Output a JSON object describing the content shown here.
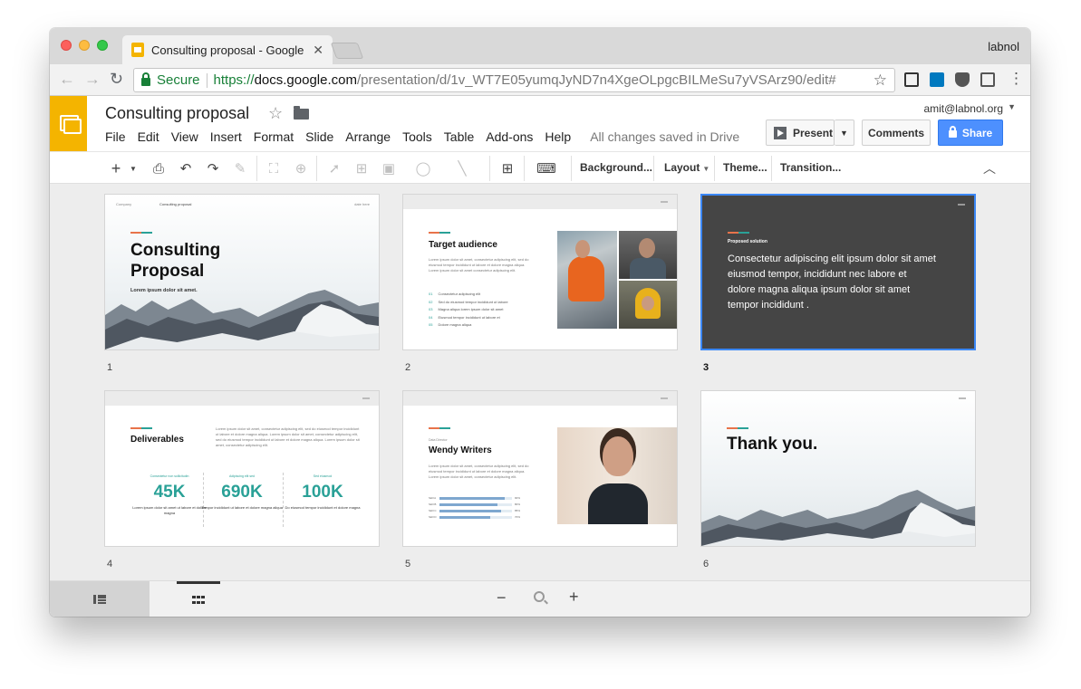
{
  "browser": {
    "tab_title": "Consulting proposal - Google S",
    "profile_name": "labnol",
    "secure_label": "Secure",
    "url_protocol": "https://",
    "url_host": "docs.google.com",
    "url_path": "/presentation/d/1v_WT7E05yumqJyND7n4XgeOLpgcBILMeSu7yVSArz90/edit#"
  },
  "docs": {
    "title": "Consulting proposal",
    "menu": [
      "File",
      "Edit",
      "View",
      "Insert",
      "Format",
      "Slide",
      "Arrange",
      "Tools",
      "Table",
      "Add-ons",
      "Help"
    ],
    "save_status": "All changes saved in Drive",
    "account": "amit@labnol.org",
    "present_label": "Present",
    "comments_label": "Comments",
    "share_label": "Share"
  },
  "toolbar": {
    "background_label": "Background...",
    "layout_label": "Layout",
    "theme_label": "Theme...",
    "transition_label": "Transition..."
  },
  "slides": [
    {
      "number": "1",
      "top_left": "Company",
      "top_mid": "Consulting proposal",
      "top_right": "date here",
      "title": "Consulting Proposal",
      "subtitle": "Lorem ipsum dolor sit amet."
    },
    {
      "number": "2",
      "title": "Target audience",
      "body": "Lorem ipsum dolor sit amet, consectetur adipiscing elit, sed do eiusmod tempor incididunt ut labore et dolore magna aliqua. Lorem ipsum dolor sit amet consectetur adipiscing elit.",
      "items": [
        {
          "n": "01",
          "text": "Consectetur adipiscing elit"
        },
        {
          "n": "02",
          "text": "Sed do eiusmod tempor incididunt ut labore"
        },
        {
          "n": "03",
          "text": "Magna aliqua lorem ipsum dolor sit amet"
        },
        {
          "n": "04",
          "text": "Eiusmod tempor incididunt ut labore et"
        },
        {
          "n": "05",
          "text": "Dolore magna aliqua"
        }
      ]
    },
    {
      "number": "3",
      "label": "Proposed solution",
      "text": "Consectetur adipiscing elit ipsum dolor sit amet eiusmod tempor, incididunt nec labore et dolore magna aliqua ipsum dolor sit amet tempor incididunt ."
    },
    {
      "number": "4",
      "title": "Deliverables",
      "body": "Lorem ipsum dolor sit amet, consectetur adipiscing elit, sed do eiusmod tempor incididunt ut labore et dolore magna aliqua. Lorem ipsum dolor sit amet, consectetur adipiscing elit, sed do eiusmod tempor incididunt ut labore et dolore magna aliqua. Lorem ipsum dolor sit amet, consectetur adipiscing elit.",
      "stats": [
        {
          "label": "Consectetur non sollicitudin",
          "value": "45K",
          "desc": "Lorem ipsum dolor sit amet ut labore et dolore magna"
        },
        {
          "label": "Adipiscing elit sed",
          "value": "690K",
          "desc": "Tempor incididunt ut labore et dolore magna aliqua"
        },
        {
          "label": "Sed eiusmod",
          "value": "100K",
          "desc": "Do eiusmod tempor incididunt et dolore magna"
        }
      ]
    },
    {
      "number": "5",
      "label": "Data Director",
      "title": "Wendy Writers",
      "body": "Lorem ipsum dolor sit amet, consectetur adipiscing elit, sed do eiusmod tempor incididunt ut labore et dolore magna aliqua. Lorem ipsum dolor sit amet, consectetur adipiscing elit.",
      "skills": [
        {
          "name": "Skill A",
          "pct": "90%",
          "fraction": 0.9
        },
        {
          "name": "Skill B",
          "pct": "80%",
          "fraction": 0.8
        },
        {
          "name": "Skill C",
          "pct": "85%",
          "fraction": 0.85
        },
        {
          "name": "Skill D",
          "pct": "70%",
          "fraction": 0.7
        }
      ]
    },
    {
      "number": "6",
      "title": "Thank you."
    }
  ]
}
